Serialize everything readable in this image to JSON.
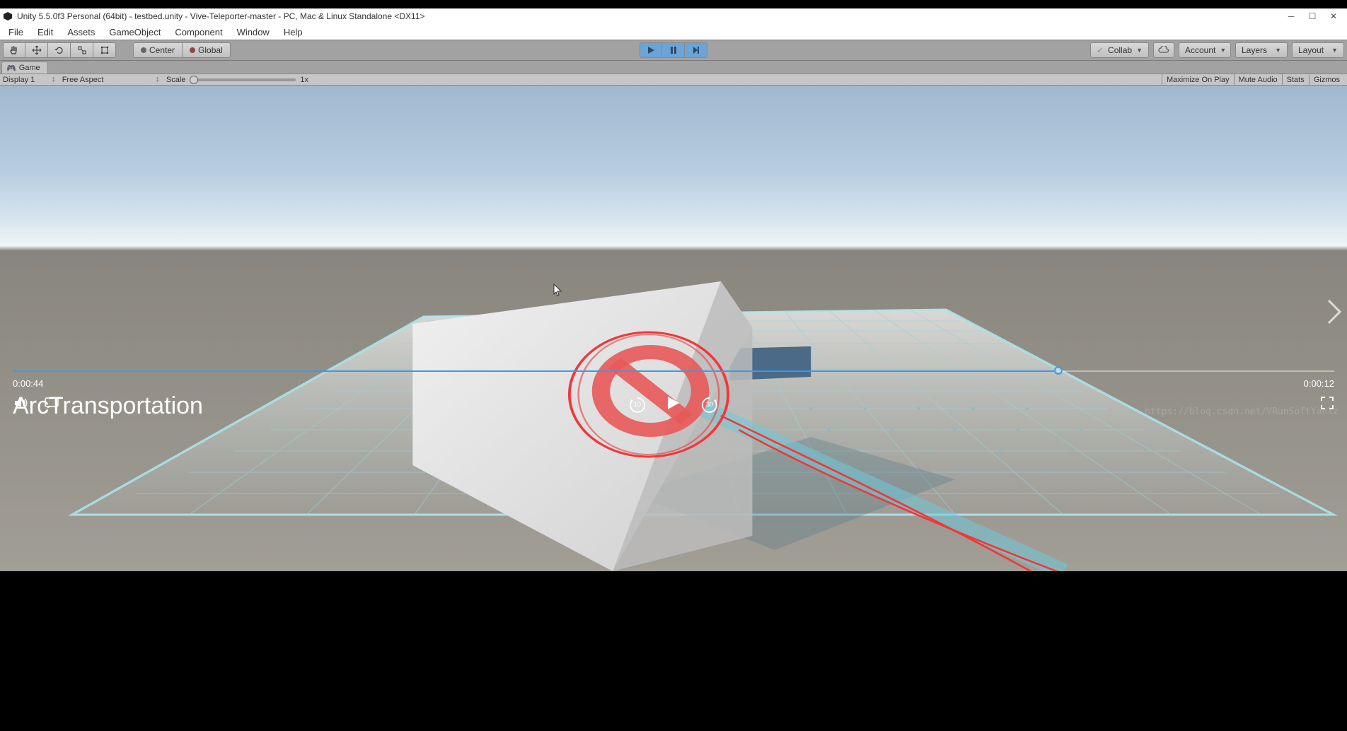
{
  "title_bar": {
    "text": "Unity 5.5.0f3 Personal (64bit) - testbed.unity - Vive-Teleporter-master - PC, Mac & Linux Standalone <DX11>"
  },
  "menu": [
    "File",
    "Edit",
    "Assets",
    "GameObject",
    "Component",
    "Window",
    "Help"
  ],
  "toolbar": {
    "pivot": "Center",
    "handle": "Global",
    "collab": "Collab",
    "account": "Account",
    "layers": "Layers",
    "layout": "Layout"
  },
  "tab": {
    "name": "Game"
  },
  "sub_toolbar": {
    "display": "Display 1",
    "aspect": "Free Aspect",
    "scale_label": "Scale",
    "scale_value": "1x",
    "maximize": "Maximize On Play",
    "mute": "Mute Audio",
    "stats": "Stats",
    "gizmos": "Gizmos"
  },
  "video": {
    "title": "ArcTransportation",
    "elapsed": "0:00:44",
    "total": "0:00:12",
    "skip_back": "10",
    "skip_fwd": "30"
  },
  "watermark": "https://blog.csdn.net/VRunSoftYanlz"
}
